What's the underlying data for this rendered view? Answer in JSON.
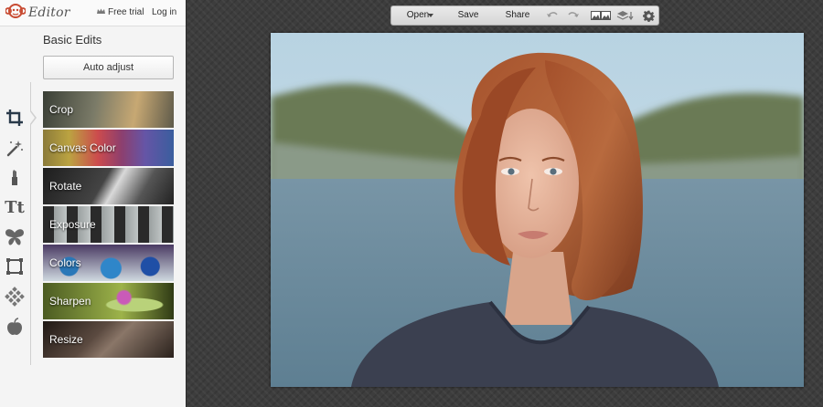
{
  "app": {
    "logo_text": "Editor",
    "free_trial_label": "Free trial",
    "login_label": "Log in"
  },
  "panel": {
    "section_title": "Basic Edits",
    "auto_adjust_label": "Auto adjust",
    "edits": [
      {
        "label": "Crop"
      },
      {
        "label": "Canvas Color"
      },
      {
        "label": "Rotate"
      },
      {
        "label": "Exposure"
      },
      {
        "label": "Colors"
      },
      {
        "label": "Sharpen"
      },
      {
        "label": "Resize"
      }
    ]
  },
  "tool_rail": {
    "items": [
      {
        "icon": "crop-icon",
        "active": true
      },
      {
        "icon": "magic-wand-icon"
      },
      {
        "icon": "lipstick-icon"
      },
      {
        "icon": "text-icon",
        "glyph": "Tt"
      },
      {
        "icon": "butterfly-icon"
      },
      {
        "icon": "frame-icon"
      },
      {
        "icon": "texture-icon"
      },
      {
        "icon": "apple-icon"
      }
    ]
  },
  "toolbar": {
    "open_label": "Open",
    "save_label": "Save",
    "share_label": "Share"
  },
  "colors": {
    "panel_bg": "#f4f4f4",
    "editor_bg": "#3d3d3d",
    "accent_icon": "#2a3a4a"
  }
}
